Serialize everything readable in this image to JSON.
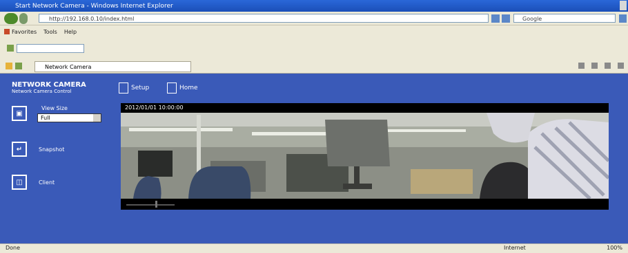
{
  "window": {
    "title": "Start Network Camera - Windows Internet Explorer"
  },
  "address_bar": {
    "url": "http://192.168.0.10/index.html"
  },
  "search": {
    "placeholder": "Google"
  },
  "menubar": {
    "items": [
      "Favorites",
      "Tools",
      "Help"
    ]
  },
  "tab": {
    "title": "Network Camera"
  },
  "brand": {
    "line1": "NETWORK CAMERA",
    "line2": "Network Camera Control"
  },
  "nav": {
    "setup": "Setup",
    "home": "Home"
  },
  "side": {
    "view_label": "View Size",
    "view_value": "Full",
    "zoom_label": "Snapshot",
    "client_label": "Client"
  },
  "video": {
    "osd": "2012/01/01 10:00:00"
  },
  "status": {
    "left": "Done",
    "middle": "Internet",
    "right": "100%"
  }
}
